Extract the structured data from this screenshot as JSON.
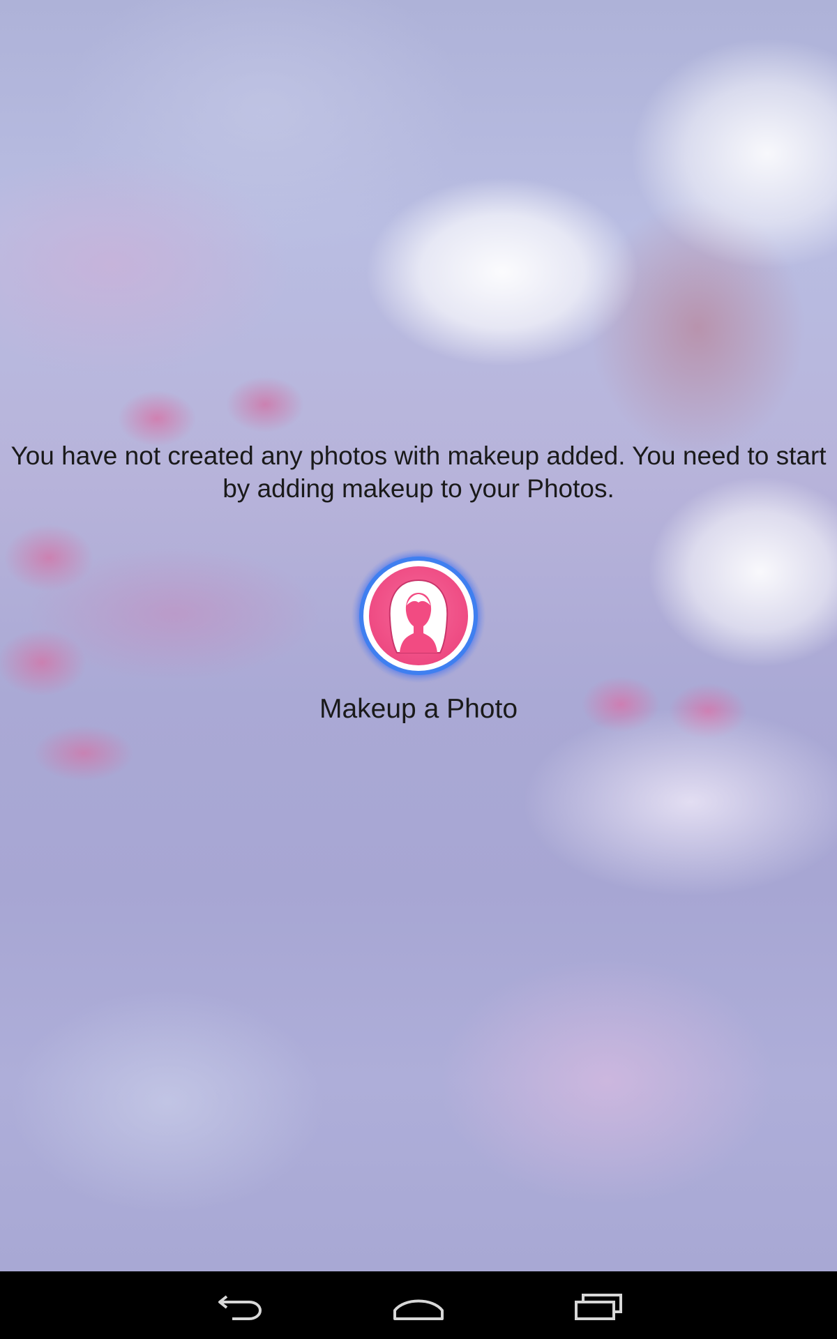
{
  "empty_state": {
    "message": "You have not created any photos with makeup added. You need to start by adding makeup to your Photos.",
    "action_label": "Makeup a Photo",
    "action_icon": "female-silhouette-icon"
  },
  "nav_bar": {
    "back_icon": "back-icon",
    "home_icon": "home-icon",
    "recents_icon": "recent-apps-icon"
  },
  "colors": {
    "button_pink": "#ee4a82",
    "button_ring_blue": "#3f7ff0",
    "nav_bar_bg": "#000000",
    "text": "#1a1a1a"
  }
}
